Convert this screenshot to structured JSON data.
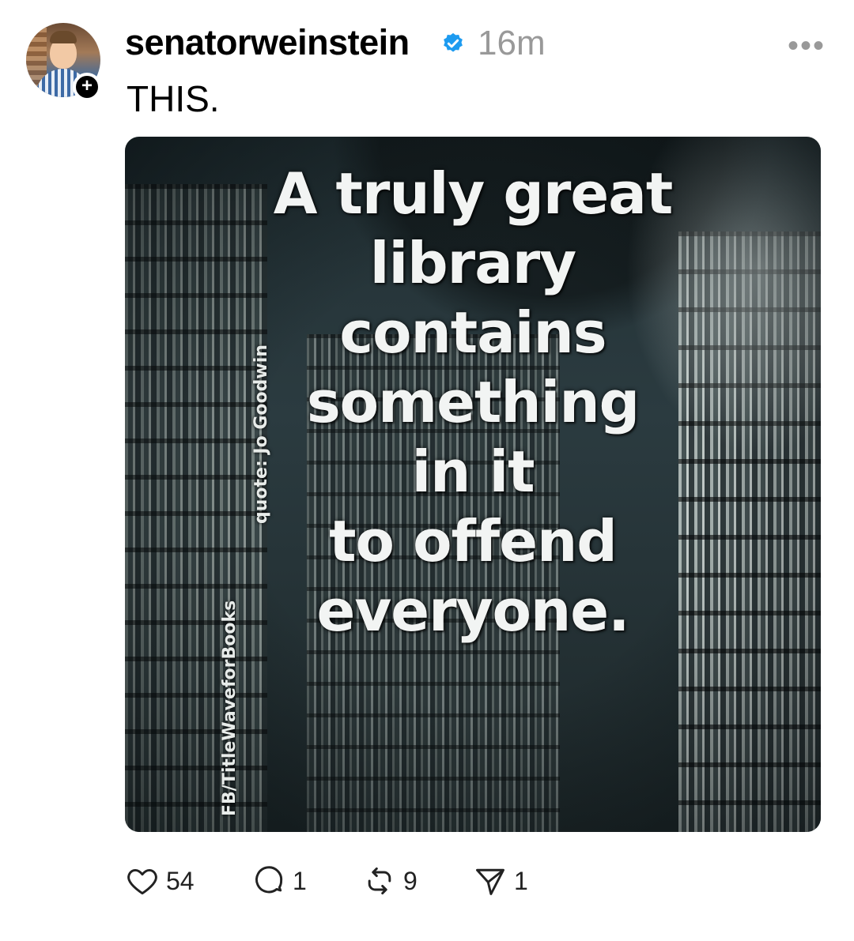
{
  "post": {
    "username": "senatorweinstein",
    "time": "16m",
    "text": "THIS.",
    "more_icon": "ellipsis-icon",
    "image": {
      "quote_lines": [
        "A truly great",
        "library",
        "contains",
        "something",
        "in it",
        "to offend",
        "everyone."
      ],
      "credit_source": "FB/TitleWaveforBooks",
      "credit_quote": "quote: Jo Goodwin"
    },
    "actions": {
      "likes": "54",
      "replies": "1",
      "reposts": "9",
      "shares": "1"
    }
  },
  "colors": {
    "verified": "#1d9bf0",
    "muted": "#999999"
  }
}
